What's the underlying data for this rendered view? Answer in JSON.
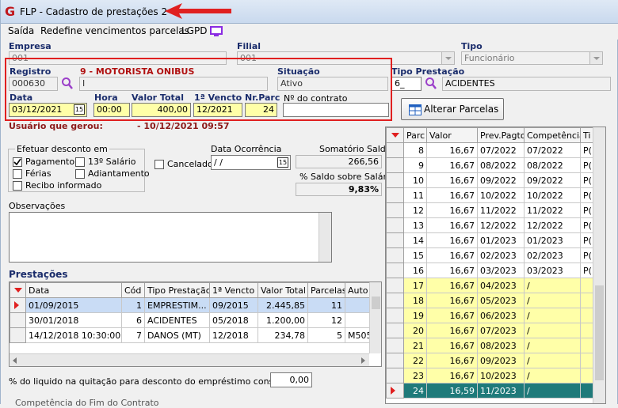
{
  "window": {
    "title": "FLP - Cadastro de prestações 2",
    "logo": "G"
  },
  "menu": {
    "exit": "Saída",
    "redefine": "Redefine vencimentos parcelas",
    "lgpd": "LGPD"
  },
  "fields": {
    "empresa_label": "Empresa",
    "empresa_value": "001",
    "filial_label": "Filial",
    "filial_value": "001",
    "tipo_label": "Tipo",
    "tipo_value": "Funcionário",
    "registro_label": "Registro",
    "registro_value": "000630",
    "employee_name": "9 - MOTORISTA ONIBUS",
    "name_value": "I",
    "situacao_label": "Situação",
    "situacao_value": "Ativo",
    "tipo_prestacao_label": "Tipo Prestação",
    "tipo_prestacao_code": "6_",
    "tipo_prestacao_value": "ACIDENTES",
    "data_label": "Data",
    "data_value": "03/12/2021",
    "hora_label": "Hora",
    "hora_value": "00:00",
    "valor_total_label": "Valor Total",
    "valor_total_value": "400,00",
    "primeiro_vencto_label": "1ª Vencto",
    "primeiro_vencto_value": "12/2021",
    "nr_parc_label": "Nr.Parc",
    "nr_parc_value": "24",
    "contrato_label": "Nº do contrato",
    "contrato_value": "",
    "usuario_label": "Usuário que gerou:",
    "usuario_value": "- 10/12/2021 09:57",
    "alterar_parcelas": "Alterar Parcelas",
    "efetuar_label": "Efetuar desconto em",
    "pagamento": "Pagamento",
    "decimo": "13º Salário",
    "ferias": "Férias",
    "adiantamento": "Adiantamento",
    "recibo": "Recibo informado",
    "cancelado": "Cancelado",
    "data_ocorrencia_label": "Data Ocorrência",
    "data_ocorrencia_value": " / /",
    "somatorio_label": "Somatório Saldo",
    "somatorio_value": "266,56",
    "pct_saldo_label": "% Saldo sobre Salário",
    "pct_saldo_value": "9,83%",
    "observacoes_label": "Observações",
    "prestacoes_label": "Prestações",
    "liquido_label": "% do liquido na quitação para desconto do empréstimo consignado",
    "liquido_value": "0,00",
    "bottom_cut": "Competência do Fim do Contrato"
  },
  "prestacoes": {
    "headers": [
      "Data",
      "Cód",
      "Tipo Prestação",
      "1ª Vencto",
      "Valor Total",
      "Parcelas",
      "Auto"
    ],
    "rows": [
      [
        "01/09/2015",
        "1",
        "EMPRESTIM...",
        "09/2015",
        "2.445,85",
        "11",
        ""
      ],
      [
        "30/01/2018",
        "6",
        "ACIDENTES",
        "05/2018",
        "1.200,00",
        "12",
        ""
      ],
      [
        "14/12/2018 10:30:00",
        "7",
        "DANOS (MT)",
        "12/2018",
        "234,78",
        "5",
        "M505"
      ]
    ]
  },
  "parcelas": {
    "headers": [
      "Parc",
      "Valor",
      "Prev.Pagto",
      "Competência",
      "Ti"
    ],
    "rows": [
      [
        "8",
        "16,67",
        "07/2022",
        "07/2022",
        "P("
      ],
      [
        "9",
        "16,67",
        "08/2022",
        "08/2022",
        "P("
      ],
      [
        "10",
        "16,67",
        "09/2022",
        "09/2022",
        "P("
      ],
      [
        "11",
        "16,67",
        "10/2022",
        "10/2022",
        "P("
      ],
      [
        "12",
        "16,67",
        "11/2022",
        "11/2022",
        "P("
      ],
      [
        "13",
        "16,67",
        "12/2022",
        "12/2022",
        "P("
      ],
      [
        "14",
        "16,67",
        "01/2023",
        "01/2023",
        "P("
      ],
      [
        "15",
        "16,67",
        "02/2023",
        "02/2023",
        "P("
      ],
      [
        "16",
        "16,67",
        "03/2023",
        "03/2023",
        "P("
      ],
      [
        "17",
        "16,67",
        "04/2023",
        "/",
        ""
      ],
      [
        "18",
        "16,67",
        "05/2023",
        "/",
        ""
      ],
      [
        "19",
        "16,67",
        "06/2023",
        "/",
        ""
      ],
      [
        "20",
        "16,67",
        "07/2023",
        "/",
        ""
      ],
      [
        "21",
        "16,67",
        "08/2023",
        "/",
        ""
      ],
      [
        "22",
        "16,67",
        "09/2023",
        "/",
        ""
      ],
      [
        "23",
        "16,67",
        "10/2023",
        "/",
        ""
      ],
      [
        "24",
        "16,59",
        "11/2023",
        "/",
        ""
      ]
    ]
  }
}
